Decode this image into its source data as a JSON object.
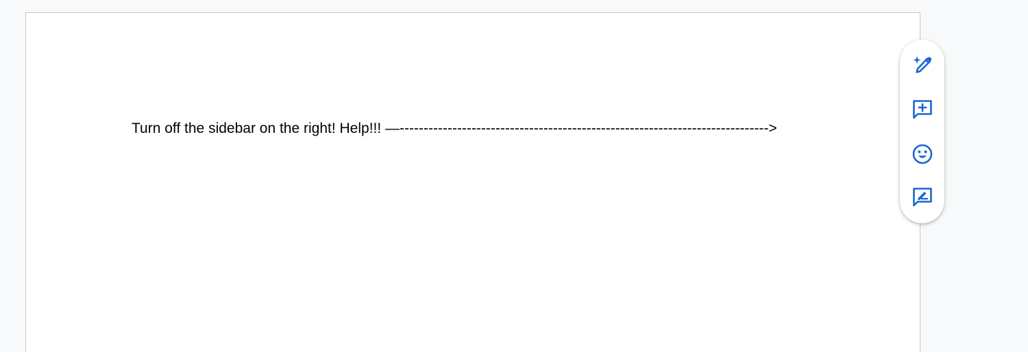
{
  "document": {
    "text": "Turn off the sidebar on the right! Help!!! —----------------------------------------------------------------------------->"
  },
  "side_toolbar": {
    "accent_color": "#1a66d2",
    "buttons": [
      {
        "icon": "pencil-sparkle-icon"
      },
      {
        "icon": "add-comment-icon"
      },
      {
        "icon": "emoji-icon"
      },
      {
        "icon": "suggest-edit-icon"
      }
    ]
  }
}
